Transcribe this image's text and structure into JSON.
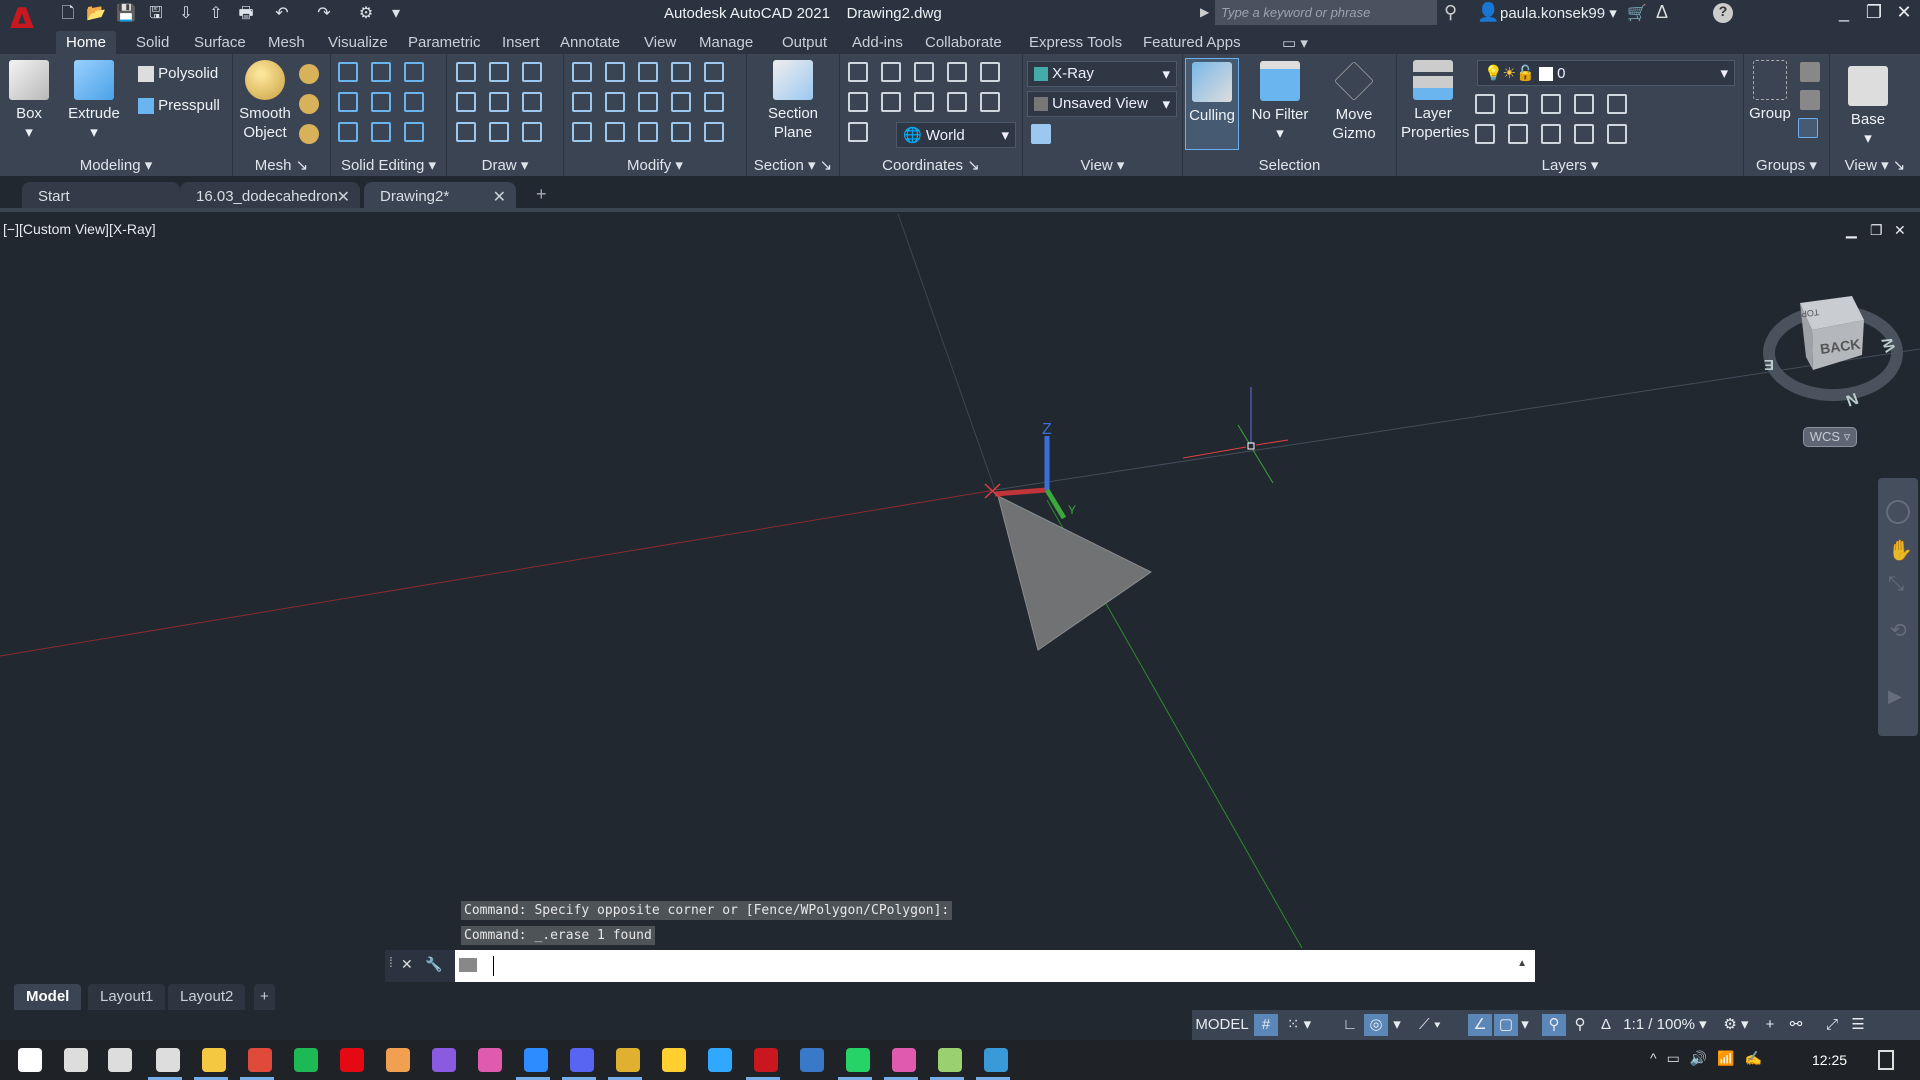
{
  "app": {
    "title": "Autodesk AutoCAD 2021",
    "document": "Drawing2.dwg",
    "logo": "A"
  },
  "quick_access": [
    "new-icon",
    "open-icon",
    "save-icon",
    "save-as-icon",
    "open-from-web-icon",
    "save-to-web-icon",
    "plot-icon",
    "undo-icon",
    "redo-icon",
    "workspace-icon",
    "customize-icon"
  ],
  "search": {
    "placeholder": "Type a keyword or phrase"
  },
  "user": {
    "name": "paula.konsek99"
  },
  "ribbon_tabs": [
    "Home",
    "Solid",
    "Surface",
    "Mesh",
    "Visualize",
    "Parametric",
    "Insert",
    "Annotate",
    "View",
    "Manage",
    "Output",
    "Add-ins",
    "Collaborate",
    "Express Tools",
    "Featured Apps"
  ],
  "active_ribbon_tab": "Home",
  "panels": {
    "modeling": {
      "label": "Modeling",
      "box": "Box",
      "extrude": "Extrude",
      "polysolid": "Polysolid",
      "presspull": "Presspull"
    },
    "mesh": {
      "label": "Mesh",
      "smooth": "Smooth\nObject"
    },
    "solid_editing": {
      "label": "Solid Editing"
    },
    "draw": {
      "label": "Draw"
    },
    "modify": {
      "label": "Modify"
    },
    "section": {
      "label": "Section",
      "section_plane": "Section\nPlane"
    },
    "coordinates": {
      "label": "Coordinates",
      "ucs": "World"
    },
    "view": {
      "label": "View",
      "visual_style": "X-Ray",
      "named_view": "Unsaved View"
    },
    "selection": {
      "label": "Selection",
      "culling": "Culling",
      "no_filter": "No Filter",
      "move_gizmo": "Move\nGizmo"
    },
    "layers": {
      "label": "Layers",
      "layer_properties": "Layer\nProperties",
      "current_layer": "0"
    },
    "groups": {
      "label": "Groups",
      "group": "Group"
    },
    "view2": {
      "label": "View",
      "base": "Base"
    }
  },
  "doc_tabs": [
    {
      "label": "Start"
    },
    {
      "label": "16.03_dodecahedron"
    },
    {
      "label": "Drawing2*"
    }
  ],
  "viewport": {
    "label": "[−][Custom View][X-Ray]",
    "viewcube": {
      "face": "BACK",
      "top": "TOP",
      "compass": [
        "N",
        "E",
        "W"
      ]
    },
    "wcs": "WCS",
    "ucs_z": "Z",
    "ucs_y": "Y"
  },
  "command": {
    "history": [
      "Command: Specify opposite corner or [Fence/WPolygon/CPolygon]:",
      "Command: _.erase 1 found"
    ],
    "input": ""
  },
  "layout_tabs": [
    "Model",
    "Layout1",
    "Layout2"
  ],
  "status": {
    "model": "MODEL",
    "scale": "1:1 / 100%"
  },
  "taskbar": {
    "time": "12:25"
  },
  "colors": {
    "x_axis": "#c0343a",
    "y_axis": "#3aa83a",
    "z_axis": "#3a6ed8",
    "background": "#212830",
    "accent": "#5b86b8"
  }
}
